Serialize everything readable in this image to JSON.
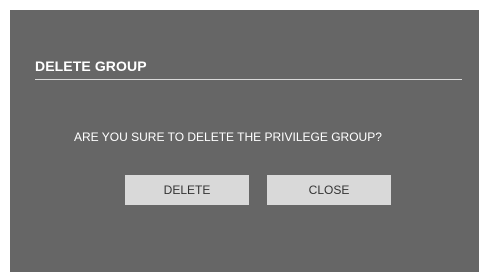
{
  "dialog": {
    "title": "DELETE GROUP",
    "message": "ARE YOU SURE TO DELETE THE PRIVILEGE GROUP?",
    "buttons": {
      "delete_label": "DELETE",
      "close_label": "CLOSE"
    }
  },
  "colors": {
    "dialog_background": "#666666",
    "button_background": "#d9d9d9",
    "text_light": "#ffffff",
    "text_dark": "#333333"
  }
}
